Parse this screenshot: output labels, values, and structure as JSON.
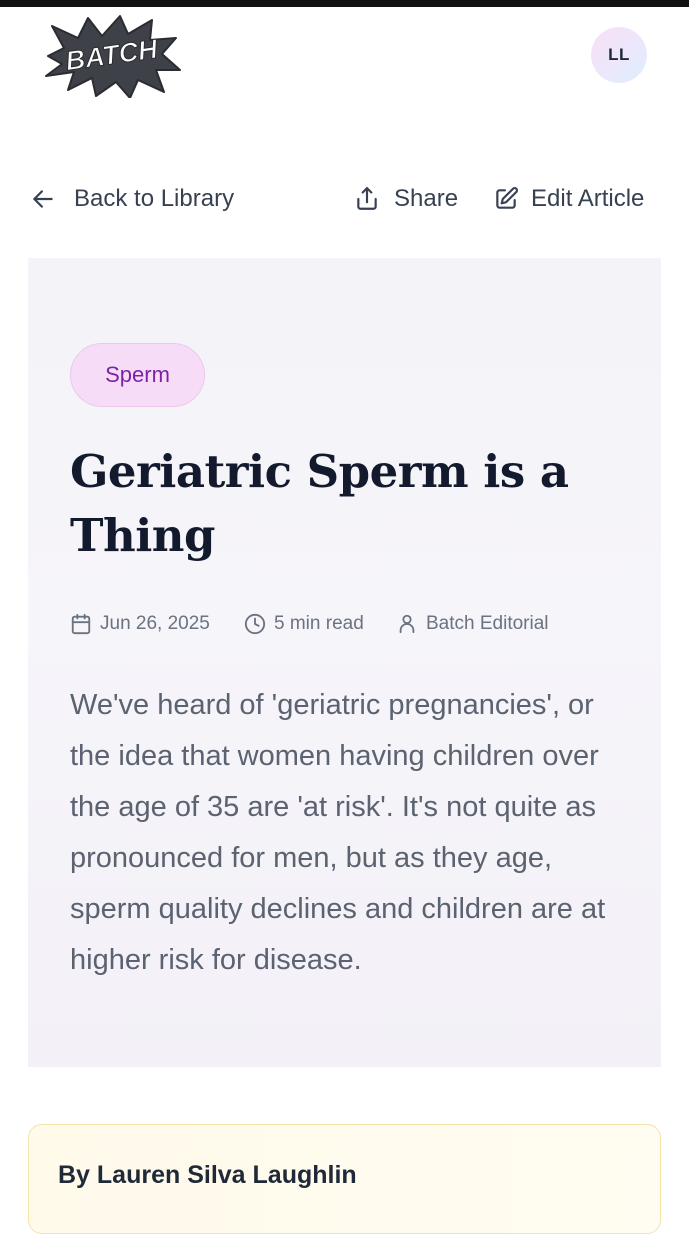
{
  "header": {
    "logo_text": "BATCH",
    "avatar_initials": "LL"
  },
  "actions": {
    "back_label": "Back to Library",
    "share_label": "Share",
    "edit_label": "Edit Article"
  },
  "article": {
    "tag": "Sperm",
    "title": "Geriatric Sperm is a Thing",
    "date": "Jun 26, 2025",
    "read_time": "5 min read",
    "author": "Batch Editorial",
    "summary": "We've heard of 'geriatric pregnancies', or the idea that women having children over the age of 35 are 'at risk'. It's not quite as pronounced for men, but as they age, sperm quality declines and children are at higher risk for disease.",
    "byline": "By Lauren Silva Laughlin"
  },
  "icons": {
    "back": "arrow-left-icon",
    "share": "share-icon",
    "edit": "edit-icon",
    "date": "calendar-icon",
    "read": "clock-icon",
    "author": "user-icon"
  },
  "colors": {
    "tag_text": "#7e22a8",
    "tag_bg": "#f6dcf6",
    "title": "#131a2e",
    "byline_card_border": "#f5e3a9"
  }
}
